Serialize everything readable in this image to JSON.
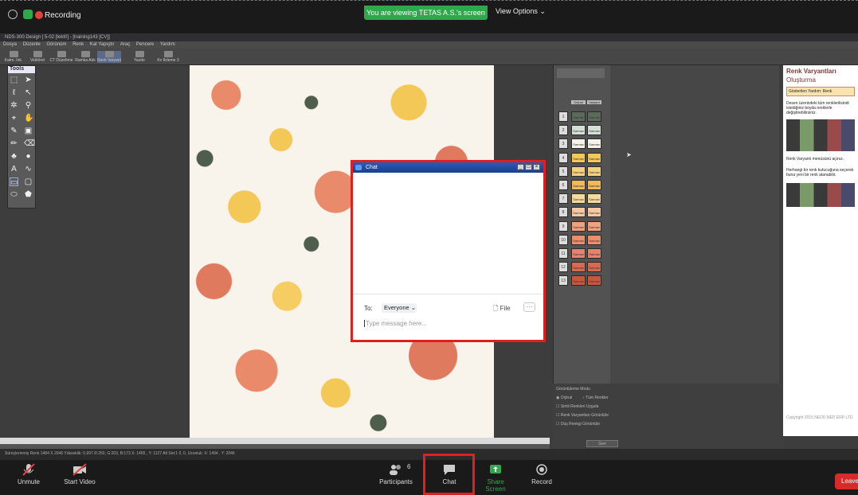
{
  "share_bar": {
    "recording": "Recording",
    "viewing_banner": "You are viewing TETAS A.S.'s screen",
    "view_options": "View Options"
  },
  "app": {
    "title": "NDS-300 Design [ 5-02 [tekt0] - [training143 [CV]]",
    "menus": [
      "Dosya",
      "Düzenle",
      "Görünüm",
      "Renk",
      "Kat Yapıştır",
      "Araç",
      "Pencere",
      "Yardım"
    ],
    "toolbar": [
      "Katm. Ink.",
      "Vektörel",
      "CT Düzeltme",
      "Ramka Atık",
      "Renk Varyant",
      "Yazdır",
      "Kv Ilzleme 3"
    ],
    "tools_title": "Tools",
    "status": "Süreçlerinmiş Renk      1484 X 2046      Yükseklik: 0,997      R:250, G:203, B:173      X: 1455 , Y: 1127      Alt Set:1  0,  0,  Uzunluk: X: 1494 , Y: 2046"
  },
  "palette": {
    "cols": [
      "Orjinal",
      "Varyant"
    ],
    "swatch_label": "Sarmax",
    "rows": [
      {
        "n": "1",
        "a": "#5a6b5a",
        "b": "#5a6b5a"
      },
      {
        "n": "2",
        "a": "#d6dfd6",
        "b": "#d6dfd6"
      },
      {
        "n": "3",
        "a": "#f7f3ea",
        "b": "#f7f3ea"
      },
      {
        "n": "4",
        "a": "#f5c85a",
        "b": "#f5c85a"
      },
      {
        "n": "5",
        "a": "#f6d27e",
        "b": "#f6d27e"
      },
      {
        "n": "6",
        "a": "#f2b85a",
        "b": "#f2b85a"
      },
      {
        "n": "7",
        "a": "#f7d8a0",
        "b": "#f7d8a0"
      },
      {
        "n": "8",
        "a": "#f6c8a4",
        "b": "#f6c8a4"
      },
      {
        "n": "9",
        "a": "#f0a27e",
        "b": "#f0a27e"
      },
      {
        "n": "10",
        "a": "#ea8e6e",
        "b": "#ea8e6e"
      },
      {
        "n": "11",
        "a": "#e8826a",
        "b": "#e8826a"
      },
      {
        "n": "12",
        "a": "#d86a4e",
        "b": "#d86a4e"
      },
      {
        "n": "13",
        "a": "#c85640",
        "b": "#c85640"
      }
    ]
  },
  "bottom_options": {
    "title": "Görüntüleme Modu",
    "option_a": "Orjinal",
    "option_b": "Tüm Renkler",
    "check_a": "Simli Renkleri Uygula",
    "check_b": "Renk Varyantları Görüntüle",
    "check_c": "Düş Renkgi Görüntüle",
    "button": "Geri"
  },
  "help": {
    "heading": "Renk Varyantları",
    "subheading": "Oluşturma",
    "tab": "Gösterilen Yardım: Renk",
    "para1": "Desen üzerindeki tüm renklerilisindi istediğiniz boyda renklerle değiştirebilirsiniz.",
    "step1": "Renk Varyantı menüsünü açınız.",
    "step2": "Herhangi bir renk kutucuğuna seçerek buna yeni bir renk atanabilir.",
    "footer": "Copyright 2015 NEDD NED ERP LTD"
  },
  "chat": {
    "title": "Chat",
    "to_label": "To:",
    "recipient": "Everyone",
    "file_label": "File",
    "placeholder": "Type message here..."
  },
  "zoom_bar": {
    "unmute": "Unmute",
    "start_video": "Start Video",
    "participants": "Participants",
    "participant_count": "6",
    "chat": "Chat",
    "share_screen": "Share Screen",
    "record": "Record",
    "leave": "Leave"
  },
  "colors": {
    "accent_green": "#2ea84a",
    "highlight_red": "#e01f1f",
    "leave_red": "#d72a2a"
  }
}
